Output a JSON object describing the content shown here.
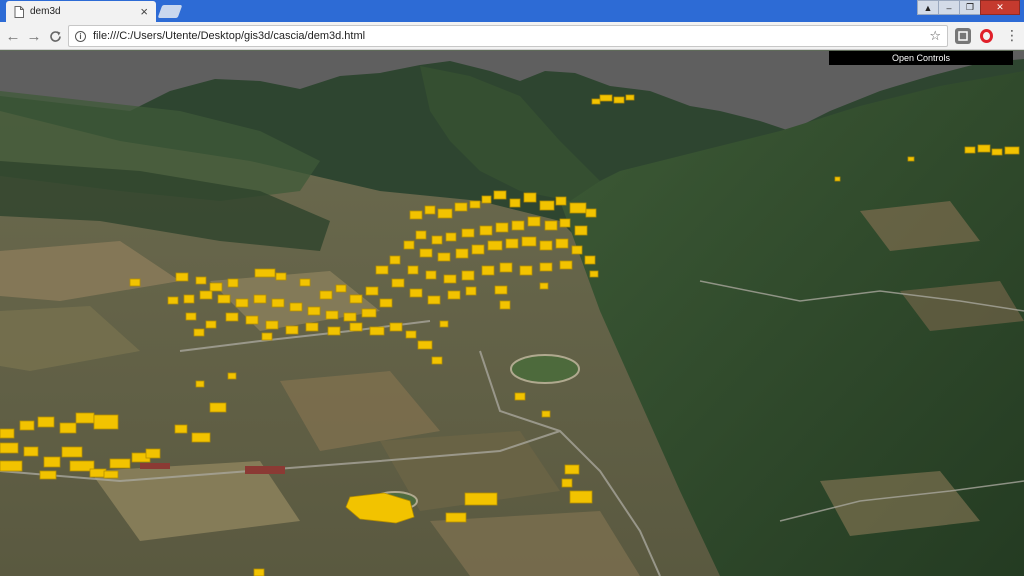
{
  "tab": {
    "title": "dem3d",
    "close": "×"
  },
  "window_controls": {
    "minimize": "–",
    "restore": "❐",
    "close": "✕",
    "profile": "▲"
  },
  "nav": {
    "back": "←",
    "forward": "→",
    "reload": "C"
  },
  "address": {
    "info": "i",
    "url": "file:///C:/Users/Utente/Desktop/gis3d/cascia/dem3d.html",
    "bookmark": "☆"
  },
  "menu": {
    "more": "⋮"
  },
  "scene": {
    "open_controls_label": "Open Controls"
  },
  "colors": {
    "sky": "#5f5f5f",
    "building": "#f2c300",
    "building_shade": "#b58f00",
    "forest": "#2f4a2c"
  }
}
